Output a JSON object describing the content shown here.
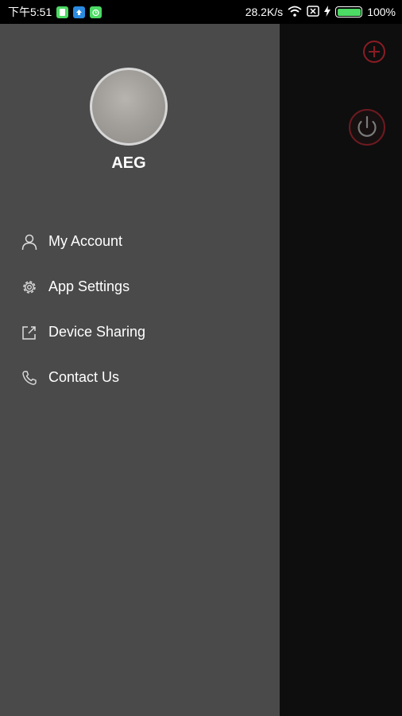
{
  "status_bar": {
    "time": "下午5:51",
    "network_speed": "28.2K/s",
    "battery_percent": "100%",
    "icons": [
      "notification-icon",
      "upload-icon",
      "alarm-icon",
      "wifi-icon",
      "sim-off-icon",
      "charging-icon",
      "battery-icon"
    ]
  },
  "profile": {
    "name": "AEG"
  },
  "menu": {
    "items": [
      {
        "label": "My Account",
        "icon": "person-icon"
      },
      {
        "label": "App Settings",
        "icon": "gear-icon"
      },
      {
        "label": "Device Sharing",
        "icon": "share-icon"
      },
      {
        "label": "Contact Us",
        "icon": "phone-icon"
      }
    ]
  },
  "main": {
    "icons": [
      "add-icon",
      "power-icon"
    ]
  },
  "colors": {
    "accent": "#8a1c24",
    "drawer_bg": "#4a4a4a",
    "battery": "#4cd964"
  }
}
